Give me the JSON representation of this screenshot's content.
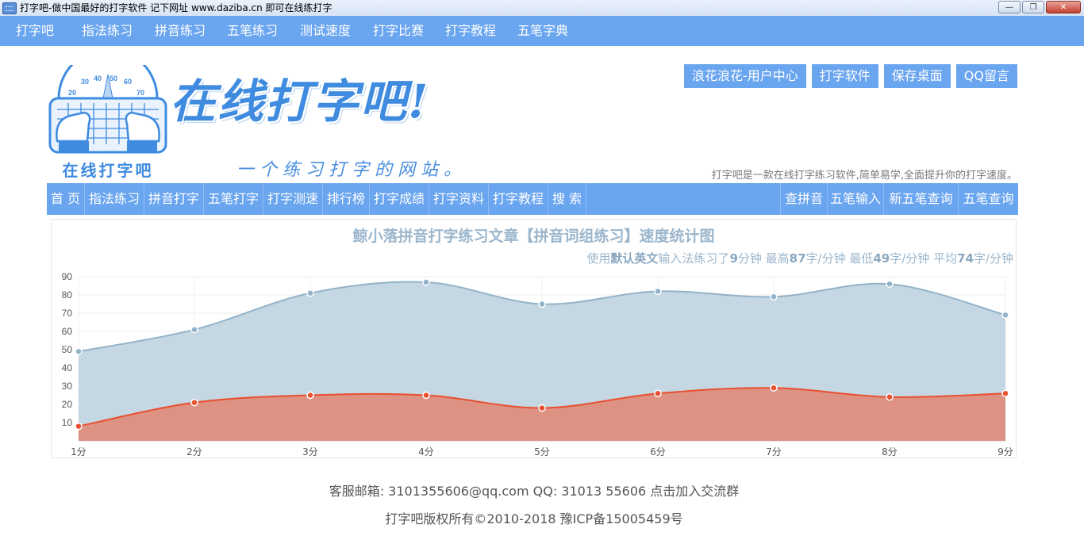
{
  "window": {
    "title": "打字吧-做中国最好的打字软件 记下网址 www.daziba.cn 即可在线练打字",
    "minimize": "—",
    "maximize": "❐",
    "close": "✕"
  },
  "top_nav": [
    "打字吧",
    "指法练习",
    "拼音练习",
    "五笔练习",
    "测试速度",
    "打字比赛",
    "打字教程",
    "五笔字典"
  ],
  "header": {
    "brand": "在线打字吧!",
    "logo_caption": "在线打字吧",
    "slogan": "一个练习打字的网站。",
    "gauge_labels": [
      "20",
      "30",
      "40",
      "50",
      "60",
      "70"
    ],
    "links": [
      "浪花浪花-用户中心",
      "打字软件",
      "保存桌面",
      "QQ留言"
    ],
    "intro": "打字吧是一款在线打字练习软件,简单易学,全面提升你的打字速度。"
  },
  "main_nav": {
    "left": [
      "首 页",
      "指法练习",
      "拼音打字",
      "五笔打字",
      "打字测速",
      "排行榜",
      "打字成绩",
      "打字资料",
      "打字教程",
      "搜 索"
    ],
    "right": [
      "查拼音",
      "五笔输入",
      "新五笔查询",
      "五笔查询"
    ]
  },
  "stats": {
    "prefix": "使用",
    "input_method": "默认英文",
    "middle": "输入法练习了",
    "minutes": "9",
    "minutes_unit": "分钟 最高",
    "max": "87",
    "max_unit": "字/分钟 最低",
    "min": "49",
    "min_unit": "字/分钟 平均",
    "avg": "74",
    "avg_unit": "字/分钟"
  },
  "chart_data": {
    "type": "area",
    "title": "鲸小落拼音打字练习文章【拼音词组练习】速度统计图",
    "categories": [
      "1分",
      "2分",
      "3分",
      "4分",
      "5分",
      "6分",
      "7分",
      "8分",
      "9分"
    ],
    "y_ticks": [
      10,
      20,
      30,
      40,
      50,
      60,
      70,
      80,
      90
    ],
    "ylim": [
      0,
      90
    ],
    "grid": true,
    "series": [
      {
        "values": [
          49,
          61,
          81,
          87,
          75,
          82,
          79,
          86,
          69
        ],
        "color": "#92b3c9",
        "fill": "#c5d7e2"
      },
      {
        "values": [
          8,
          21,
          25,
          25,
          18,
          26,
          29,
          24,
          26
        ],
        "color": "#e8502f",
        "fill": "#de9283"
      }
    ]
  },
  "footer": {
    "contact": "客服邮箱: 3101355606@qq.com QQ: 31013 55606 点击加入交流群",
    "copyright": "打字吧版权所有©2010-2018 豫ICP备15005459号"
  },
  "colors": {
    "nav_blue": "#6aa5ef",
    "brand_blue": "#3e8be0",
    "series_blue": "#92b3c9",
    "series_red": "#e8502f"
  }
}
